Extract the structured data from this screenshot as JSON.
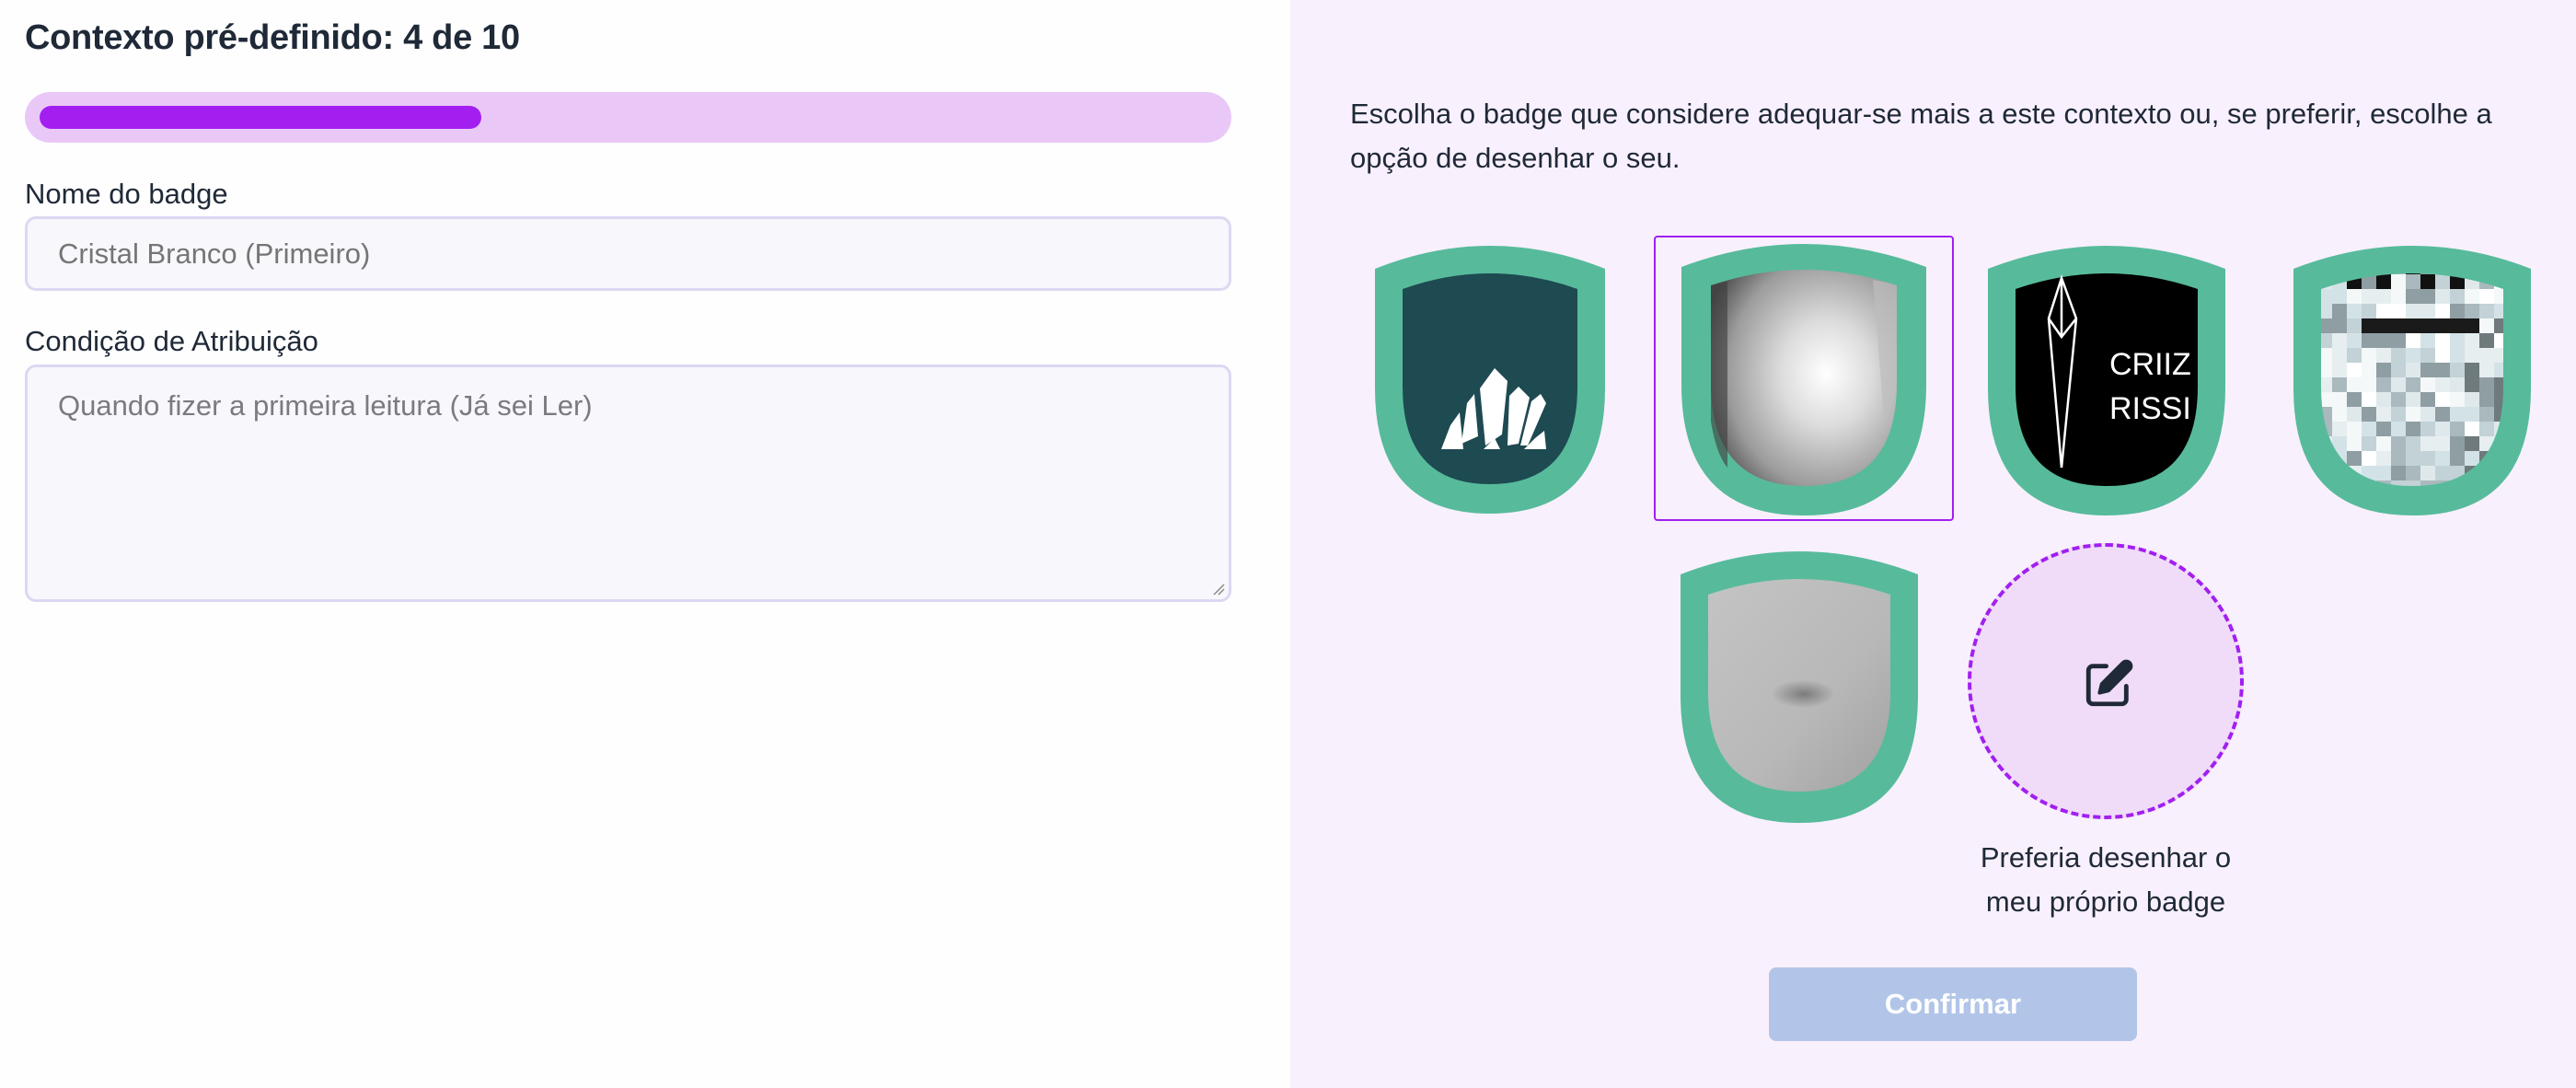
{
  "header": {
    "title": "Contexto pré-definido: 4 de 10",
    "progress_fraction": 0.4
  },
  "form": {
    "name_label": "Nome do badge",
    "name_placeholder": "Cristal Branco (Primeiro)",
    "condition_label": "Condição de Atribuição",
    "condition_placeholder": "Quando fizer a primeira leitura (Já sei Ler)"
  },
  "chooser": {
    "instructions": "Escolha o badge que considere adequar-se mais a este contexto ou, se preferir, escolhe a opção de desenhar o seu.",
    "badges": [
      {
        "name": "crystal-cluster-badge",
        "selected": false
      },
      {
        "name": "silver-blur-badge",
        "selected": true
      },
      {
        "name": "crystal-text-badge",
        "text_lines": [
          "CRIIZ",
          "RISSI"
        ],
        "selected": false
      },
      {
        "name": "pixel-crystal-badge",
        "selected": false
      },
      {
        "name": "grey-stone-badge",
        "selected": false
      }
    ],
    "draw_option_caption": "Preferia desenhar o meu próprio badge",
    "confirm_label": "Confirmar"
  },
  "colors": {
    "accent": "#a21ff0",
    "progress_track": "#e9c8f7",
    "badge_frame": "#57bb9b",
    "confirm_disabled": "#b2c5e8",
    "right_panel_bg": "#f9f0fd"
  },
  "icons": {
    "draw": "edit-pencil-square-icon"
  }
}
